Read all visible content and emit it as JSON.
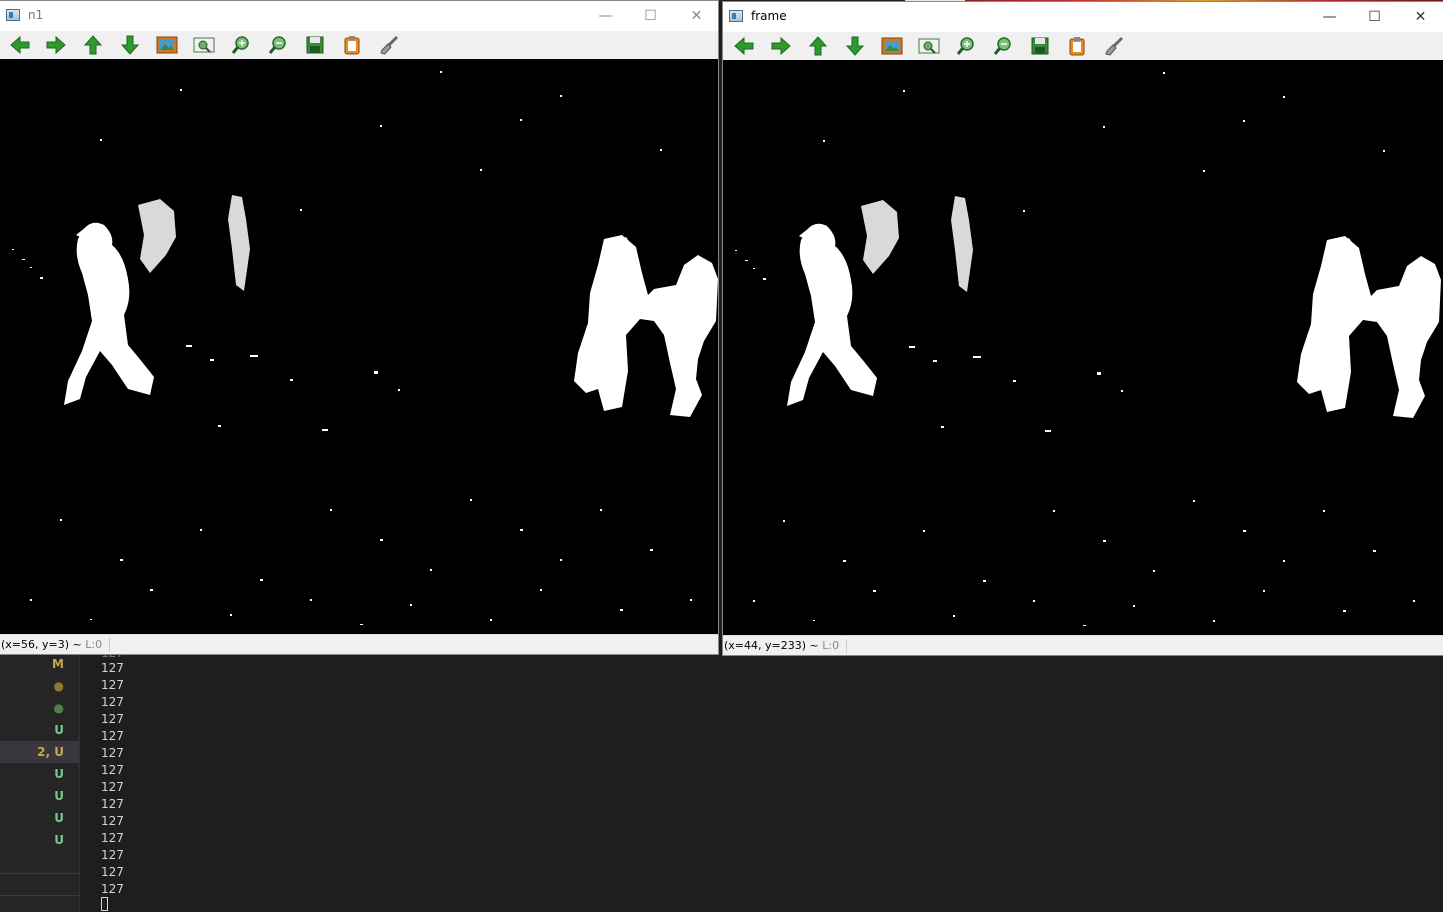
{
  "window_left": {
    "title": "n1",
    "status_coord": "(x=56, y=3) ~",
    "status_level": "L:0"
  },
  "window_right": {
    "title": "frame",
    "status_coord": "(x=44, y=233) ~",
    "status_level": "L:0"
  },
  "window_controls": {
    "minimize": "—",
    "maximize": "☐",
    "close": "✕"
  },
  "toolbar": [
    {
      "name": "pan-left-button",
      "icon": "arrow-left-icon"
    },
    {
      "name": "pan-right-button",
      "icon": "arrow-right-icon"
    },
    {
      "name": "pan-up-button",
      "icon": "arrow-up-icon"
    },
    {
      "name": "pan-down-button",
      "icon": "arrow-down-icon"
    },
    {
      "name": "zoom-original-button",
      "icon": "picture-icon"
    },
    {
      "name": "zoom-fit-button",
      "icon": "zoom-fit-icon"
    },
    {
      "name": "zoom-in-button",
      "icon": "zoom-in-icon"
    },
    {
      "name": "zoom-out-button",
      "icon": "zoom-out-icon"
    },
    {
      "name": "save-button",
      "icon": "floppy-disk-icon"
    },
    {
      "name": "copy-button",
      "icon": "clipboard-icon"
    },
    {
      "name": "properties-button",
      "icon": "brush-icon"
    }
  ],
  "scm_gutter": [
    {
      "label": "M",
      "color": "#c8a84a"
    },
    {
      "label": "●",
      "color": "#8c7a30"
    },
    {
      "label": "●",
      "color": "#4e7d4e"
    },
    {
      "label": "U",
      "color": "#73c991"
    },
    {
      "label": "2, U",
      "color": "#c8a84a",
      "selected": true
    },
    {
      "label": "U",
      "color": "#73c991"
    },
    {
      "label": "U",
      "color": "#73c991"
    },
    {
      "label": "U",
      "color": "#73c991"
    },
    {
      "label": "U",
      "color": "#73c991"
    }
  ],
  "output_lines": [
    "127",
    "127",
    "127",
    "127",
    "127",
    "127",
    "127",
    "127",
    "127",
    "127",
    "127",
    "127",
    "127",
    "127"
  ],
  "colors": {
    "arrow_green": "#2e9a2e",
    "titlebar": "#ffffff",
    "toolbar": "#f0f0f0",
    "canvas": "#000000"
  }
}
